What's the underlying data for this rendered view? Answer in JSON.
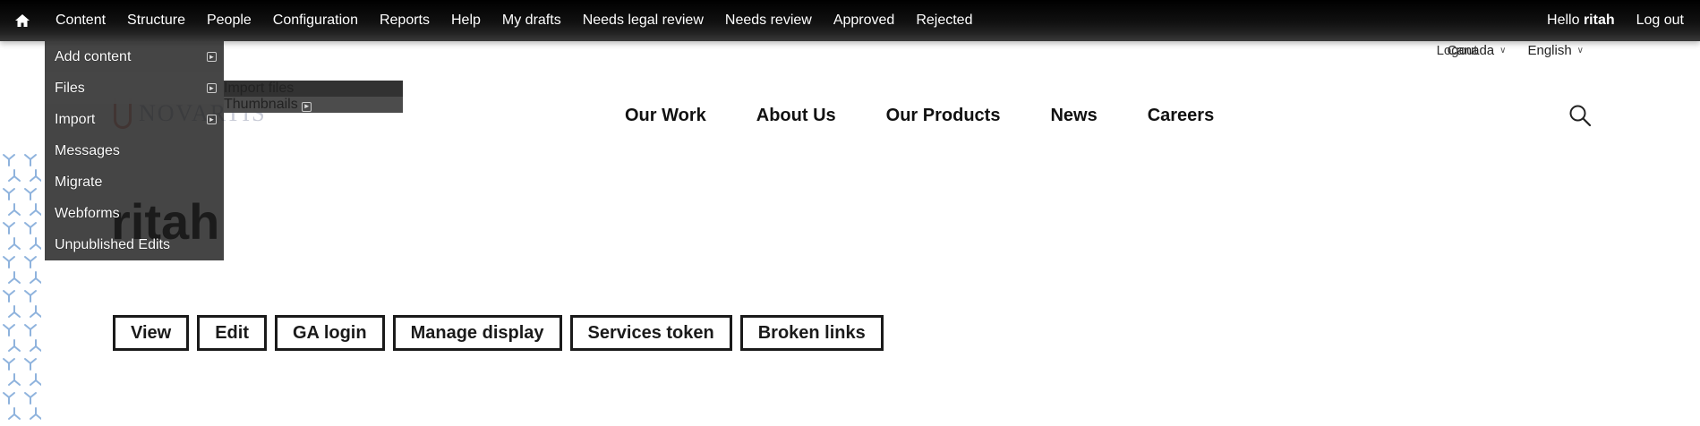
{
  "admin_bar": {
    "home_icon": "home-icon",
    "menu": [
      "Content",
      "Structure",
      "People",
      "Configuration",
      "Reports",
      "Help",
      "My drafts",
      "Needs legal review",
      "Needs review",
      "Approved",
      "Rejected"
    ],
    "greeting": "Hello",
    "username": "ritah",
    "logout": "Log out"
  },
  "content_menu": {
    "items": [
      {
        "label": "Add content",
        "expandable": true
      },
      {
        "label": "Files",
        "expandable": true
      },
      {
        "label": "Import",
        "expandable": true
      },
      {
        "label": "Messages",
        "expandable": false
      },
      {
        "label": "Migrate",
        "expandable": false
      },
      {
        "label": "Webforms",
        "expandable": false
      },
      {
        "label": "Unpublished Edits",
        "expandable": false
      }
    ]
  },
  "files_submenu": {
    "items": [
      {
        "label": "Import files",
        "expandable": false
      },
      {
        "label": "Thumbnails",
        "expandable": true
      }
    ]
  },
  "site_header": {
    "logo_text": "NOVARTIS",
    "language_bar": {
      "logout_overlap": "Logout",
      "country": "Canada",
      "language": "English"
    },
    "nav": [
      "Our Work",
      "About Us",
      "Our Products",
      "News",
      "Careers"
    ],
    "search_icon": "search-icon"
  },
  "page": {
    "title": "ritah"
  },
  "tabs": [
    "View",
    "Edit",
    "GA login",
    "Manage display",
    "Services token",
    "Broken links"
  ],
  "colors": {
    "toolbar_bg": "#000000",
    "dropdown_bg": "#1c1c1c",
    "logo_accent": "#e8a49b",
    "pattern_blue": "#8fb3dd"
  }
}
